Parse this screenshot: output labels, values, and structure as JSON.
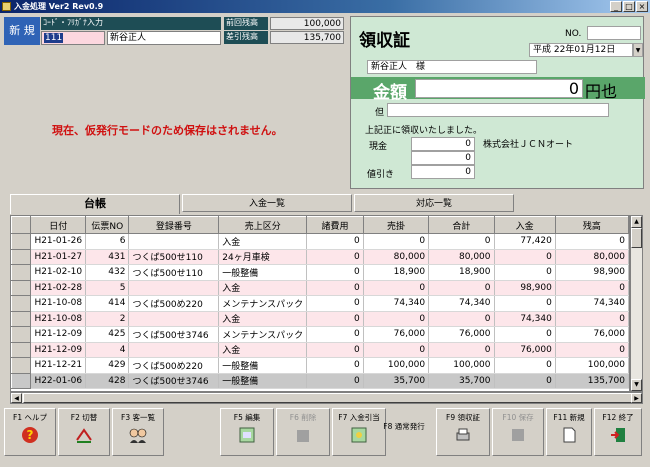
{
  "window": {
    "title": "入金処理 Ver2 Rev0.9",
    "minimize": "_",
    "maximize": "□",
    "close": "×"
  },
  "mode": "新 規",
  "code_label": "ｺｰﾄﾞ・ﾌﾘｶﾞﾅ入力",
  "code_value": "111",
  "customer_name": "新谷正人",
  "prev_balance_label": "前回残高",
  "prev_balance": "100,000",
  "diff_balance_label": "差引残高",
  "diff_balance": "135,700",
  "warning": "現在、仮発行モードのため保存はされません。",
  "receipt": {
    "title": "領収証",
    "no_label": "NO.",
    "no_value": "",
    "date": "平成 22年01月12日",
    "dropdown": "▼",
    "addressee": "新谷正人　様",
    "amount_label": "金額",
    "amount_value": "0",
    "amount_unit": "円也",
    "tadashi_label": "但",
    "tadashi_value": "",
    "received": "上記正に領収いたしました。",
    "company": "株式会社ＪＣＮオート",
    "cash_label": "現金",
    "cash_value": "0",
    "other_value": "0",
    "discount_label": "値引き",
    "discount_value": "0"
  },
  "tabs": [
    "台帳",
    "入金一覧",
    "対応一覧"
  ],
  "ledger": {
    "columns": [
      "日付",
      "伝票NO",
      "登録番号",
      "売上区分",
      "諸費用",
      "売掛",
      "合計",
      "入金",
      "残高"
    ],
    "rows": [
      {
        "date": "H21-01-26",
        "no": "6",
        "reg": "",
        "type": "入金",
        "fee": "0",
        "ar": "0",
        "total": "0",
        "paid": "77,420",
        "bal": "0",
        "style": ""
      },
      {
        "date": "H21-01-27",
        "no": "431",
        "reg": "つくば500せ110",
        "type": "24ヶ月車検",
        "fee": "0",
        "ar": "80,000",
        "total": "80,000",
        "paid": "0",
        "bal": "80,000",
        "style": "pink"
      },
      {
        "date": "H21-02-10",
        "no": "432",
        "reg": "つくば500せ110",
        "type": "一般整備",
        "fee": "0",
        "ar": "18,900",
        "total": "18,900",
        "paid": "0",
        "bal": "98,900",
        "style": ""
      },
      {
        "date": "H21-02-28",
        "no": "5",
        "reg": "",
        "type": "入金",
        "fee": "0",
        "ar": "0",
        "total": "0",
        "paid": "98,900",
        "bal": "0",
        "style": "pink"
      },
      {
        "date": "H21-10-08",
        "no": "414",
        "reg": "つくば500め220",
        "type": "メンテナンスパック",
        "fee": "0",
        "ar": "74,340",
        "total": "74,340",
        "paid": "0",
        "bal": "74,340",
        "style": ""
      },
      {
        "date": "H21-10-08",
        "no": "2",
        "reg": "",
        "type": "入金",
        "fee": "0",
        "ar": "0",
        "total": "0",
        "paid": "74,340",
        "bal": "0",
        "style": "pink"
      },
      {
        "date": "H21-12-09",
        "no": "425",
        "reg": "つくば500せ3746",
        "type": "メンテナンスパック",
        "fee": "0",
        "ar": "76,000",
        "total": "76,000",
        "paid": "0",
        "bal": "76,000",
        "style": ""
      },
      {
        "date": "H21-12-09",
        "no": "4",
        "reg": "",
        "type": "入金",
        "fee": "0",
        "ar": "0",
        "total": "0",
        "paid": "76,000",
        "bal": "0",
        "style": "pink"
      },
      {
        "date": "H21-12-21",
        "no": "429",
        "reg": "つくば500め220",
        "type": "一般整備",
        "fee": "0",
        "ar": "100,000",
        "total": "100,000",
        "paid": "0",
        "bal": "100,000",
        "style": ""
      },
      {
        "date": "H22-01-06",
        "no": "428",
        "reg": "つくば500せ3746",
        "type": "一般整備",
        "fee": "0",
        "ar": "35,700",
        "total": "35,700",
        "paid": "0",
        "bal": "135,700",
        "style": "hi"
      }
    ]
  },
  "fkeys": [
    {
      "label": "F1 ヘルプ",
      "icon": "help-icon",
      "enabled": true
    },
    {
      "label": "F2 切替",
      "icon": "switch-icon",
      "enabled": true
    },
    {
      "label": "F3 客一覧",
      "icon": "customers-icon",
      "enabled": true
    },
    {
      "label": "F5 編集",
      "icon": "edit-icon",
      "enabled": true
    },
    {
      "label": "F6 削除",
      "icon": "delete-icon",
      "enabled": false
    },
    {
      "label": "F7 入金引当",
      "icon": "payment-icon",
      "enabled": true
    },
    {
      "label": "F8 通常発行",
      "icon": "",
      "enabled": true
    },
    {
      "label": "F9 領収証",
      "icon": "printer-icon",
      "enabled": true
    },
    {
      "label": "F10 保存",
      "icon": "save-icon",
      "enabled": false
    },
    {
      "label": "F11 新規",
      "icon": "new-icon",
      "enabled": true
    },
    {
      "label": "F12 終了",
      "icon": "exit-icon",
      "enabled": true
    }
  ]
}
